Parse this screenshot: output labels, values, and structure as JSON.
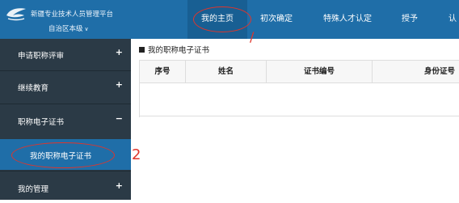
{
  "header": {
    "title": "新疆专业技术人员管理平台",
    "region": "自治区本级",
    "region_caret": "∨",
    "nav": [
      {
        "label": "我的主页",
        "active": true
      },
      {
        "label": "初次确定",
        "active": false
      },
      {
        "label": "特殊人才认定",
        "active": false
      },
      {
        "label": "授予",
        "active": false
      },
      {
        "label": "认",
        "active": false
      }
    ]
  },
  "sidebar": {
    "items": [
      {
        "label": "申请职称评审",
        "sign": "+"
      },
      {
        "label": "继续教育",
        "sign": "+"
      },
      {
        "label": "职称电子证书",
        "sign": "−"
      },
      {
        "label": "我的管理",
        "sign": "+"
      }
    ],
    "sub_items": [
      {
        "label": "我的职称电子证书"
      }
    ]
  },
  "main": {
    "title": "我的职称电子证书",
    "table": {
      "columns": [
        "序号",
        "姓名",
        "证书编号",
        "身份证号"
      ],
      "rows": []
    }
  },
  "annotations": {
    "marker1": "/",
    "marker2": "2",
    "color": "#e0352b"
  },
  "colors": {
    "header_bg": "#1f6ea8",
    "sidebar_bg": "#2b3a46",
    "active_sub_bg": "#1f6ea8"
  }
}
